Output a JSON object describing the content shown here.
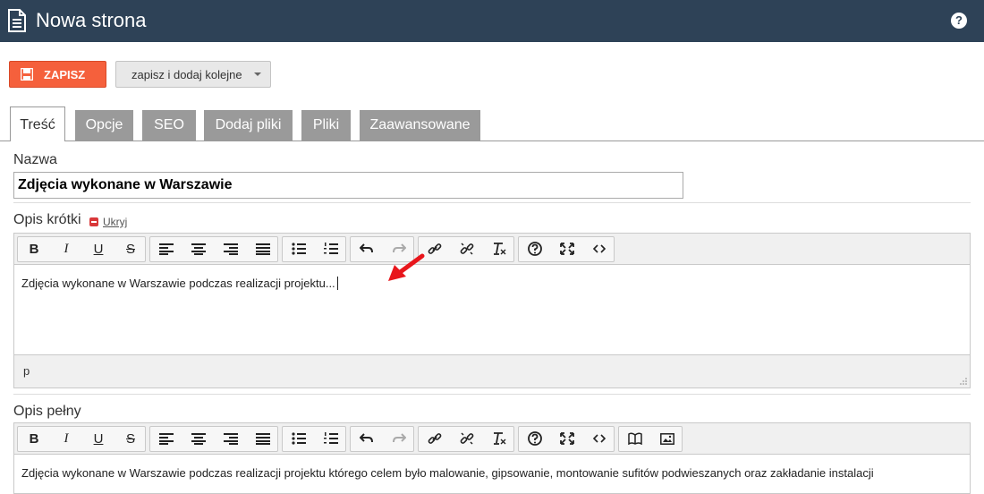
{
  "header": {
    "title": "Nowa strona",
    "help": "?"
  },
  "actions": {
    "save_label": "ZAPISZ",
    "save_more_label": "zapisz i dodaj kolejne"
  },
  "tabs": [
    {
      "label": "Treść",
      "active": true
    },
    {
      "label": "Opcje"
    },
    {
      "label": "SEO"
    },
    {
      "label": "Dodaj pliki"
    },
    {
      "label": "Pliki"
    },
    {
      "label": "Zaawansowane"
    }
  ],
  "name_field": {
    "label": "Nazwa",
    "value": "Zdjęcia wykonane w Warszawie"
  },
  "short_desc": {
    "label": "Opis krótki",
    "hide_link": "Ukryj",
    "content": "Zdjęcia wykonane w Warszawie podczas realizacji projektu...",
    "status_path": "p"
  },
  "full_desc": {
    "label": "Opis pełny",
    "content": "Zdjęcia wykonane w Warszawie podczas realizacji projektu którego celem było malowanie, gipsowanie, montowanie sufitów podwieszanych oraz zakładanie instalacji"
  },
  "toolbar_labels": {
    "bold": "B",
    "italic": "I",
    "underline": "U",
    "strike": "S"
  },
  "colors": {
    "header_bg": "#2e4257",
    "save_bg": "#f5603c",
    "tab_inactive": "#9a9a9a"
  }
}
